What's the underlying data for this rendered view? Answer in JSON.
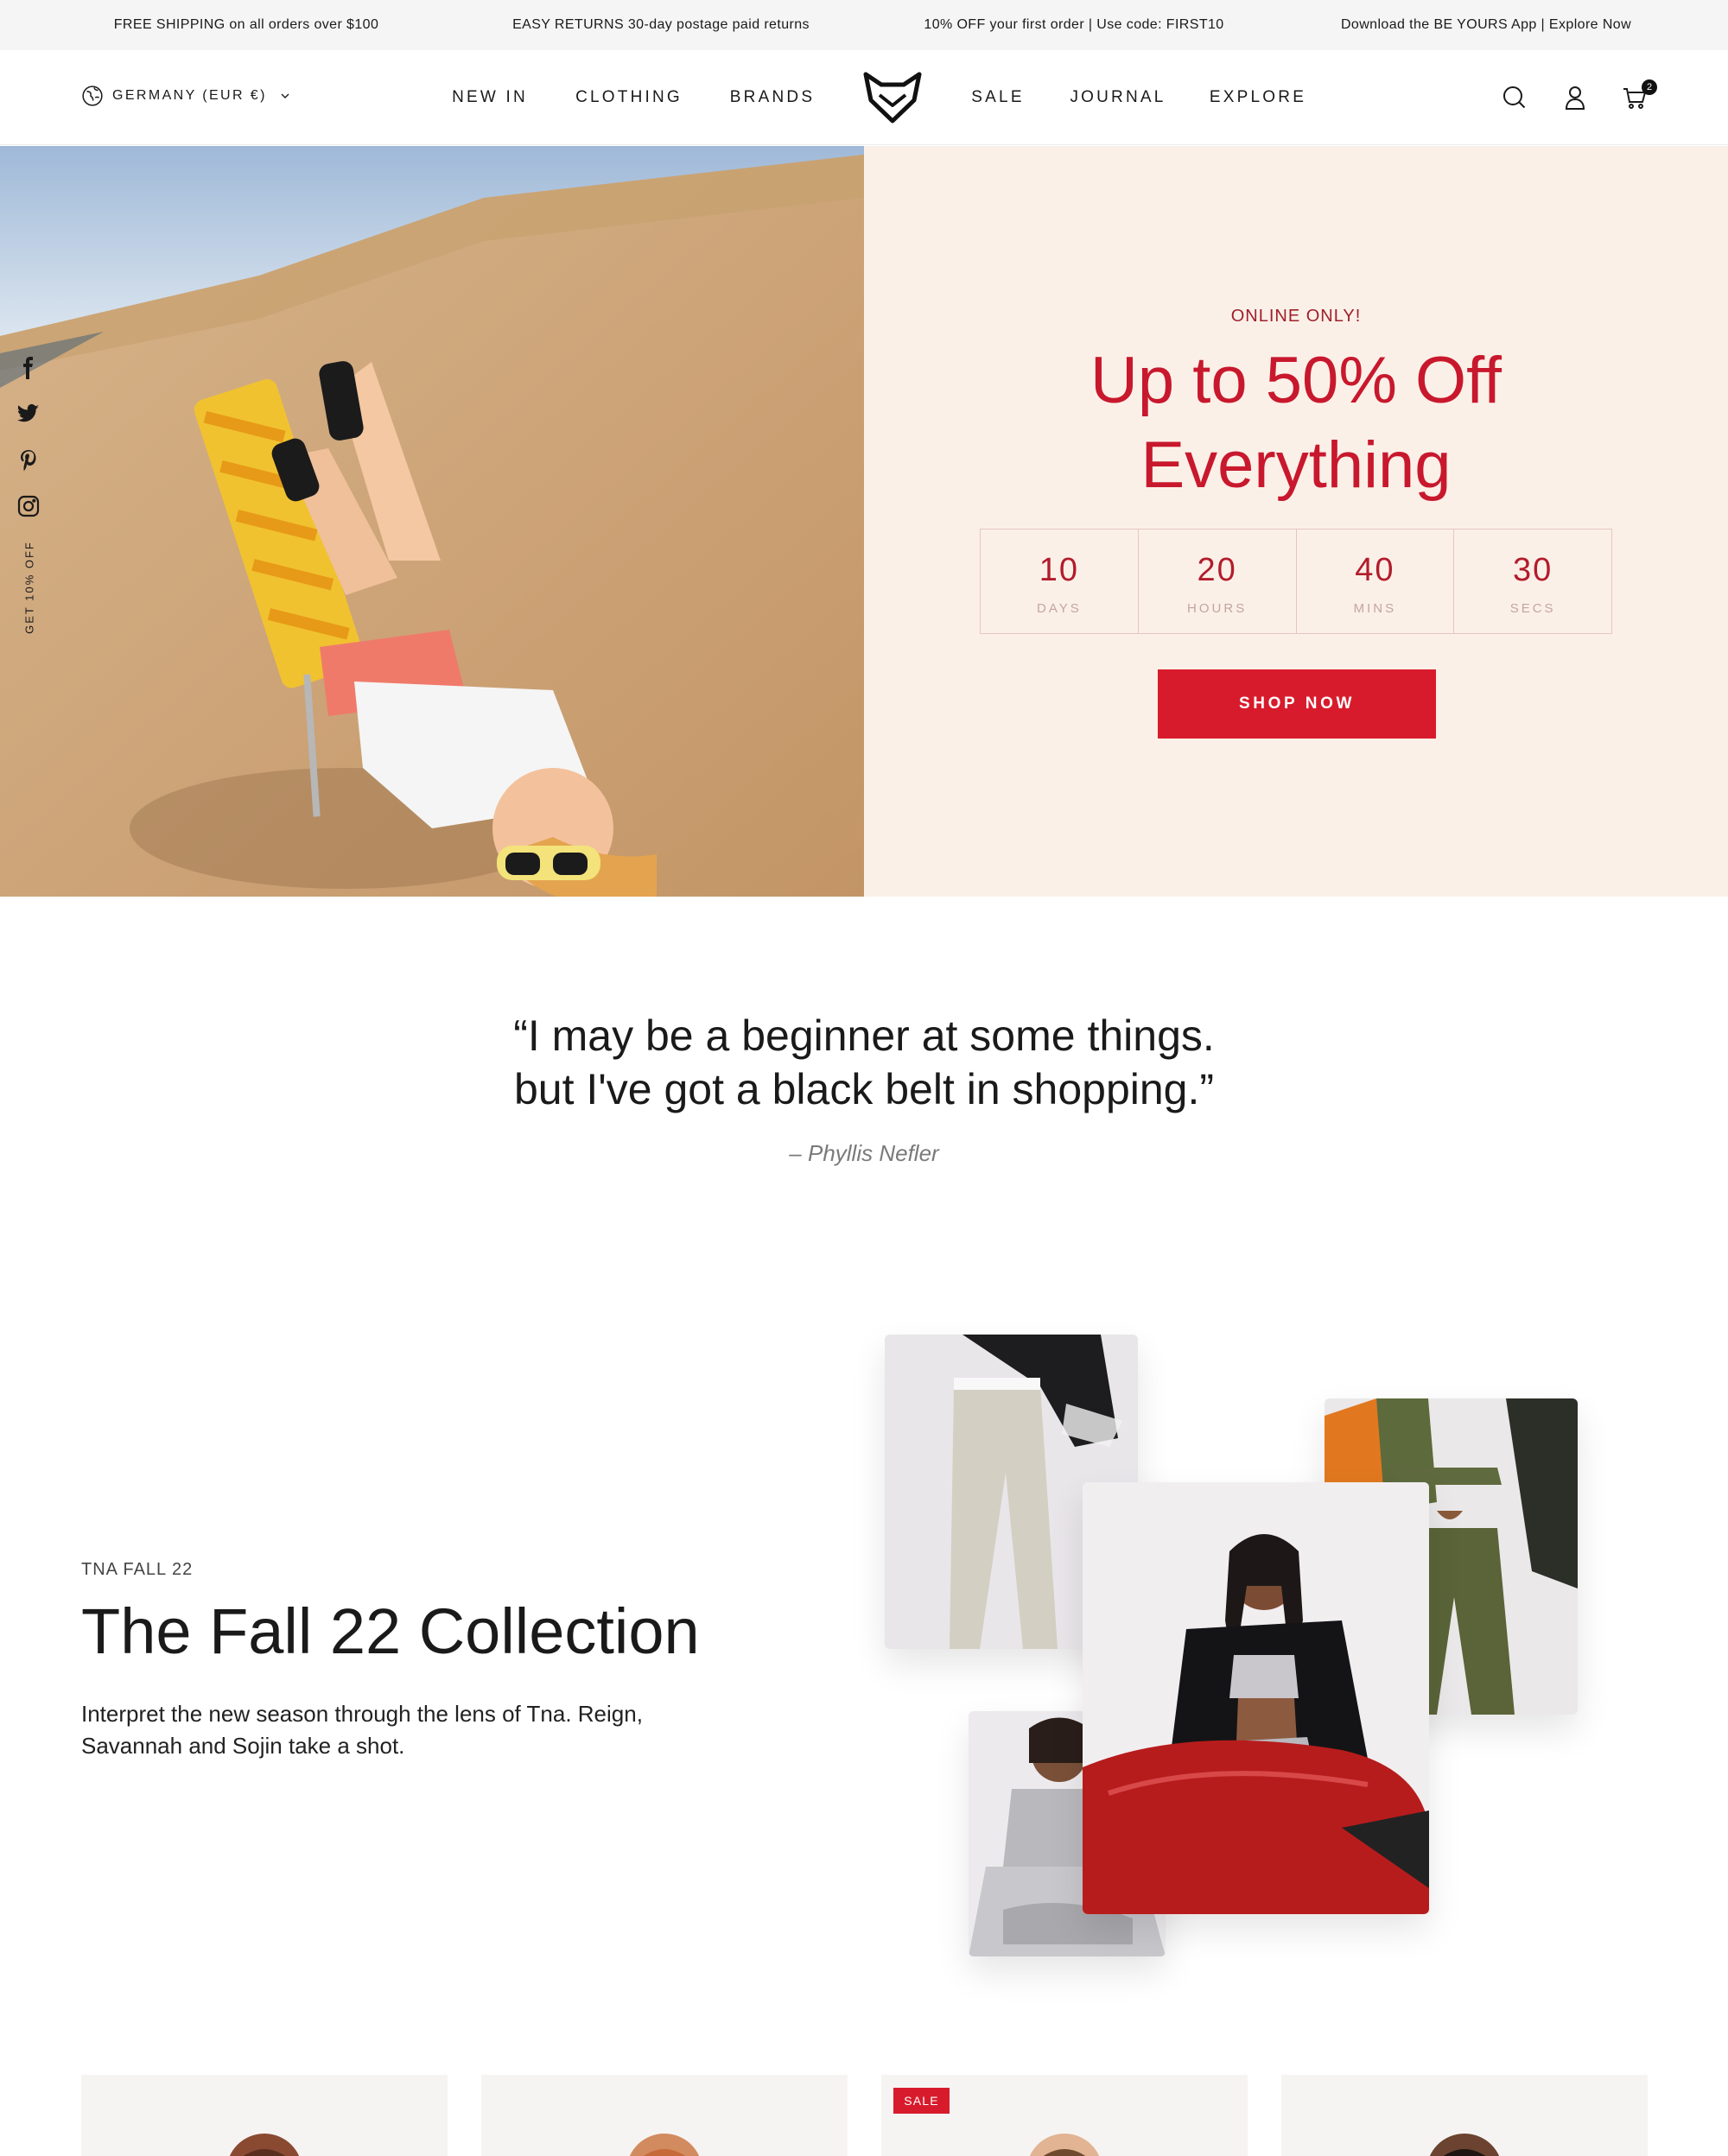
{
  "announcement": [
    "FREE SHIPPING on all orders over $100",
    "EASY RETURNS 30-day postage paid returns",
    "10% OFF your first order | Use code: FIRST10",
    "Download the BE YOURS App | Explore Now"
  ],
  "header": {
    "country": "GERMANY (EUR €)",
    "nav_left": [
      "NEW IN",
      "CLOTHING",
      "BRANDS"
    ],
    "nav_right": [
      "SALE",
      "JOURNAL",
      "EXPLORE"
    ],
    "cart_count": "2",
    "icons": [
      "globe-icon",
      "chevron-down-icon",
      "search-icon",
      "account-icon",
      "cart-icon"
    ]
  },
  "hero": {
    "eyebrow": "ONLINE ONLY!",
    "title": "Up to 50% Off Everything",
    "countdown": [
      {
        "value": "10",
        "label": "DAYS"
      },
      {
        "value": "20",
        "label": "HOURS"
      },
      {
        "value": "40",
        "label": "MINS"
      },
      {
        "value": "30",
        "label": "SECS"
      }
    ],
    "cta": "SHOP NOW",
    "side_tab": "GET 10% OFF",
    "social_icons": [
      "facebook-icon",
      "twitter-icon",
      "pinterest-icon",
      "instagram-icon"
    ]
  },
  "quote": {
    "line1": "“I may be a beginner at some things.",
    "line2": "but I've got a black belt in shopping.”",
    "author": "– Phyllis Nefler"
  },
  "collection": {
    "label": "TNA FALL 22",
    "title": "The Fall 22 Collection",
    "text": "Interpret the new season through the lens of Tna. Reign, Savannah and Sojin take a shot."
  },
  "products": {
    "sale_badge": "SALE"
  },
  "colors": {
    "accent": "#d81b2c",
    "hero_panel": "#fbf0e8",
    "title_red": "#c8182d"
  }
}
